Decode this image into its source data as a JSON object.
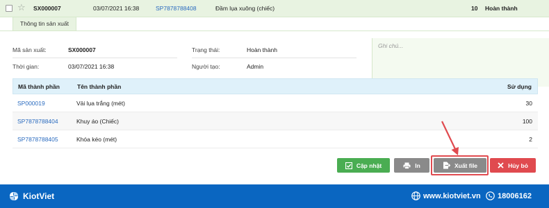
{
  "header_row": {
    "code": "SX000007",
    "time": "03/07/2021 16:38",
    "product_code": "SP7878788408",
    "product_name": "Đầm lụa xuông (chiếc)",
    "quantity": "10",
    "status": "Hoàn thành"
  },
  "tab": {
    "label": "Thông tin sản xuất"
  },
  "info": {
    "code_label": "Mã sản xuất:",
    "code_value": "SX000007",
    "time_label": "Thời gian:",
    "time_value": "03/07/2021 16:38",
    "status_label": "Trạng thái:",
    "status_value": "Hoàn thành",
    "creator_label": "Người tạo:",
    "creator_value": "Admin",
    "note_placeholder": "Ghi chú..."
  },
  "table": {
    "headers": {
      "code": "Mã thành phần",
      "name": "Tên thành phần",
      "usage": "Sử dụng"
    },
    "rows": [
      {
        "code": "SP000019",
        "name": "Vải lụa trắng (mét)",
        "usage": "30"
      },
      {
        "code": "SP7878788404",
        "name": "Khuy áo (Chiếc)",
        "usage": "100"
      },
      {
        "code": "SP7878788405",
        "name": "Khóa kéo (mét)",
        "usage": "2"
      }
    ]
  },
  "buttons": {
    "update": "Cập nhật",
    "print": "In",
    "export": "Xuất file",
    "cancel": "Hủy bỏ"
  },
  "footer": {
    "brand": "KiotViet",
    "website": "www.kiotviet.vn",
    "phone": "18006162"
  },
  "colors": {
    "green": "#4aad52",
    "gray": "#8a8a8a",
    "red": "#e04a4f",
    "link_blue": "#2a6bbf",
    "footer_blue": "#0a66c1"
  }
}
